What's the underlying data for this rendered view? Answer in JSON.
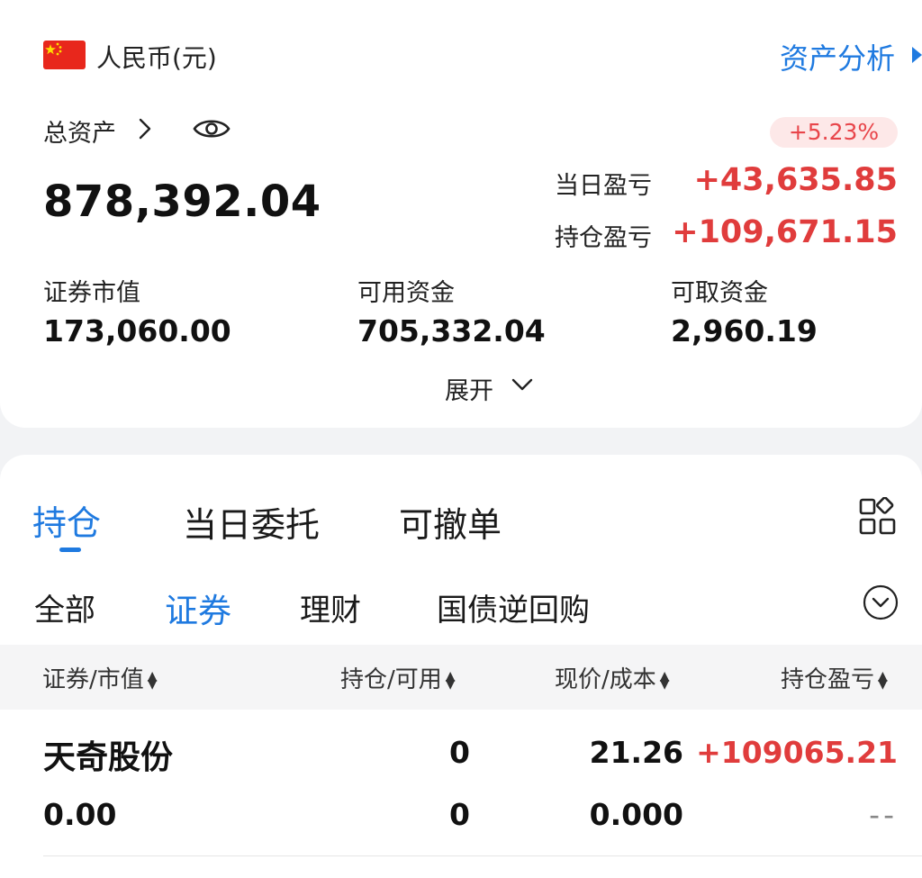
{
  "account": {
    "currency": "人民币(元)",
    "analysis_link": "资产分析",
    "total_assets_label": "总资产",
    "total_assets_value": "878,392.04",
    "change_pct": "+5.23%",
    "daily_pl_label": "当日盈亏",
    "daily_pl_value": "+43,635.85",
    "position_pl_label": "持仓盈亏",
    "position_pl_value": "+109,671.15",
    "stats": [
      {
        "label": "证券市值",
        "value": "173,060.00"
      },
      {
        "label": "可用资金",
        "value": "705,332.04"
      },
      {
        "label": "可取资金",
        "value": "2,960.19"
      }
    ],
    "expand_label": "展开"
  },
  "tabs": [
    {
      "label": "持仓",
      "active": true
    },
    {
      "label": "当日委托",
      "active": false
    },
    {
      "label": "可撤单",
      "active": false
    }
  ],
  "filters": [
    {
      "label": "全部",
      "active": false
    },
    {
      "label": "证券",
      "active": true
    },
    {
      "label": "理财",
      "active": false
    },
    {
      "label": "国债逆回购",
      "active": false
    }
  ],
  "table": {
    "columns": [
      "证券/市值",
      "持仓/可用",
      "现价/成本",
      "持仓盈亏"
    ],
    "rows": [
      {
        "name": "天奇股份",
        "market_value": "0.00",
        "position": "0",
        "available": "0",
        "price": "21.26",
        "cost": "0.000",
        "pl": "+109065.21",
        "pl_sub": "--"
      }
    ]
  },
  "colors": {
    "accent": "#1f7ae0",
    "gain": "#e03c3c",
    "flag": "#e8271c"
  }
}
